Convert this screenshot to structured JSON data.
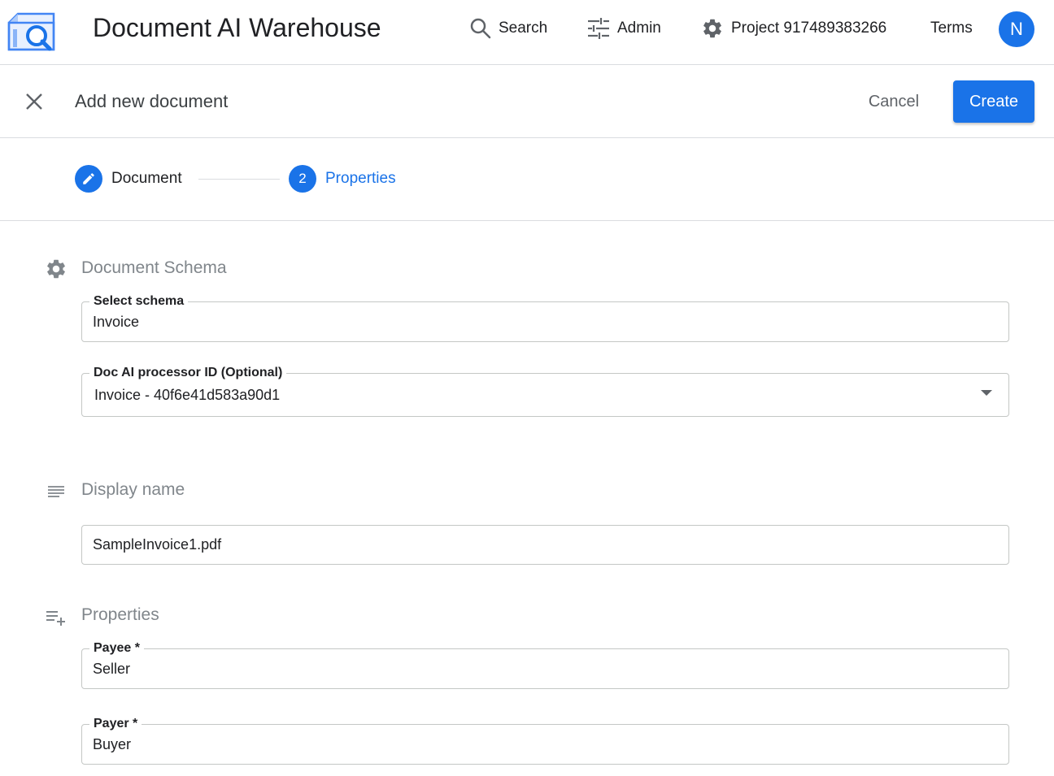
{
  "header": {
    "app_title": "Document AI Warehouse",
    "nav": {
      "search": "Search",
      "admin": "Admin",
      "project": "Project 917489383266",
      "terms": "Terms"
    },
    "avatar_initial": "N"
  },
  "action_bar": {
    "title": "Add new document",
    "cancel_label": "Cancel",
    "create_label": "Create"
  },
  "stepper": {
    "steps": [
      {
        "label": "Document",
        "state": "edit-icon"
      },
      {
        "number": "2",
        "label": "Properties"
      }
    ]
  },
  "schema_section": {
    "title": "Document Schema",
    "select_schema": {
      "label": "Select schema",
      "value": "Invoice"
    },
    "processor": {
      "label": "Doc AI processor ID (Optional)",
      "value": "Invoice - 40f6e41d583a90d1"
    }
  },
  "display_name_section": {
    "title": "Display name",
    "value": "SampleInvoice1.pdf"
  },
  "properties_section": {
    "title": "Properties",
    "fields": [
      {
        "label": "Payee *",
        "value": "Seller"
      },
      {
        "label": "Payer *",
        "value": "Buyer"
      }
    ]
  },
  "colors": {
    "primary": "#1a73e8",
    "border": "#dadce0",
    "muted_text": "#80868b"
  }
}
